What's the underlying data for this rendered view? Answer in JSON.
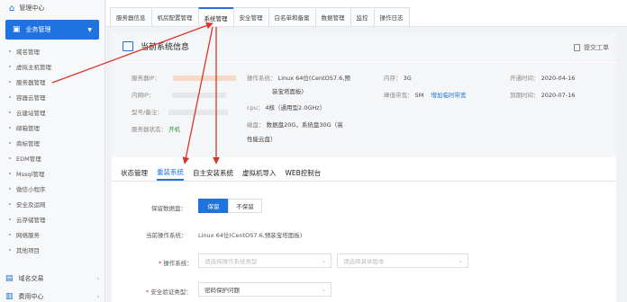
{
  "sidebar": {
    "top_label": "管理中心",
    "active_label": "业务管理",
    "sub_items": [
      "域名管理",
      "虚拟主机管理",
      "服务器管理",
      "容器云管理",
      "云建站管理",
      "邮箱管理",
      "商标管理",
      "EDM管理",
      "Mssql管理",
      "微信小程序",
      "安全及运网",
      "云存储管理",
      "网络服务",
      "其他项目"
    ],
    "group1_label": "域名交易",
    "group2_label": "费用中心"
  },
  "topnav": {
    "tabs": [
      "服务器信息",
      "机房配置管理",
      "系统管理",
      "安全管理",
      "白名单和备案",
      "数据管理",
      "监控",
      "操作日志"
    ],
    "active_index": 2
  },
  "info": {
    "title": "当前系统信息",
    "ticket_label": "提交工单",
    "server_ip_label": "服务器IP：",
    "inner_ip_label": "内网IP：",
    "model_label": "型号/备注：",
    "status_label": "服务器状态：",
    "status_value": "开机",
    "os_label": "操作系统：",
    "os_value_1": "Linux 64位(CentOS7.6,预",
    "os_value_2": "装宝塔面板)",
    "cpu_label": "cpu：",
    "cpu_value": "4核（通用型2.0GHz）",
    "disk_label": "磁盘：",
    "disk_value_1": "数据盘20G，系统盘30G（高",
    "disk_value_2": "性能云盘）",
    "mem_label": "内存：",
    "mem_value": "3G",
    "bw_label": "峰值带宽：",
    "bw_value": "5M",
    "bw_link": "增加临时带宽",
    "open_label": "开通时间：",
    "open_value": "2020-04-16",
    "expire_label": "到期时间：",
    "expire_value": "2020-07-16"
  },
  "subtabs": {
    "items": [
      "状态管理",
      "重装系统",
      "自主安装系统",
      "虚拟机导入",
      "WEB控制台"
    ],
    "active_index": 1
  },
  "form": {
    "keep_data_label": "保留数据盘：",
    "keep_btn": "保留",
    "nokeep_btn": "不保留",
    "current_os_label": "当前操作系统：",
    "current_os_value": "Linux 64位(CentOS7.6,预装宝塔面板)",
    "os_label": "操作系统：",
    "os_type_placeholder": "请选择操作系统类型",
    "os_version_placeholder": "请选择具体版本",
    "verify_label": "安全验证类型：",
    "verify_value": "密码保护问题"
  },
  "colors": {
    "accent": "#1f73e0",
    "annotation_arrow": "#d9342b",
    "status_green": "#2a9d3b"
  }
}
